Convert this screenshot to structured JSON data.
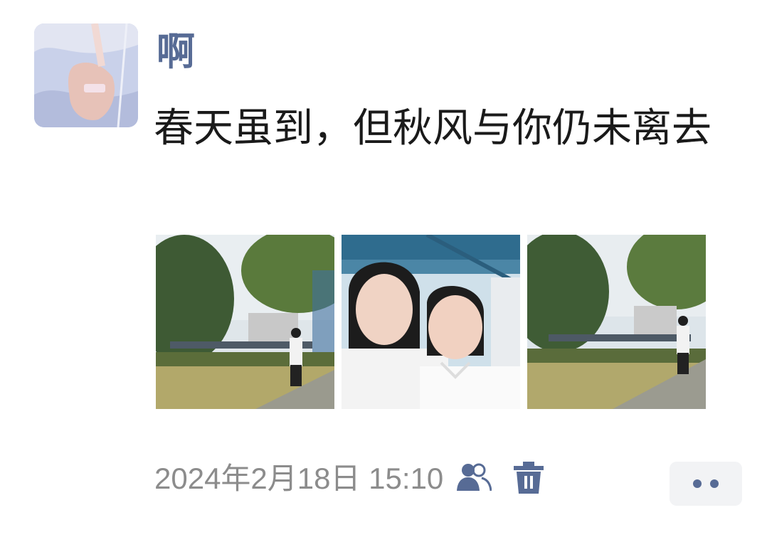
{
  "post": {
    "username": "啊",
    "text": "春天虽到，但秋风与你仍未离去",
    "timestamp": "2024年2月18日 15:10",
    "photos": [
      {
        "id": "photo-1",
        "icon": "park-photo"
      },
      {
        "id": "photo-2",
        "icon": "selfie-photo"
      },
      {
        "id": "photo-3",
        "icon": "park-photo"
      }
    ],
    "icons": {
      "visibility": "friends-icon",
      "delete": "trash-icon",
      "more": "more-dots-icon"
    }
  },
  "colors": {
    "link_blue": "#576b95",
    "text": "#1a1a1a",
    "meta": "#8c8c8c",
    "more_bg": "#f2f3f5"
  }
}
